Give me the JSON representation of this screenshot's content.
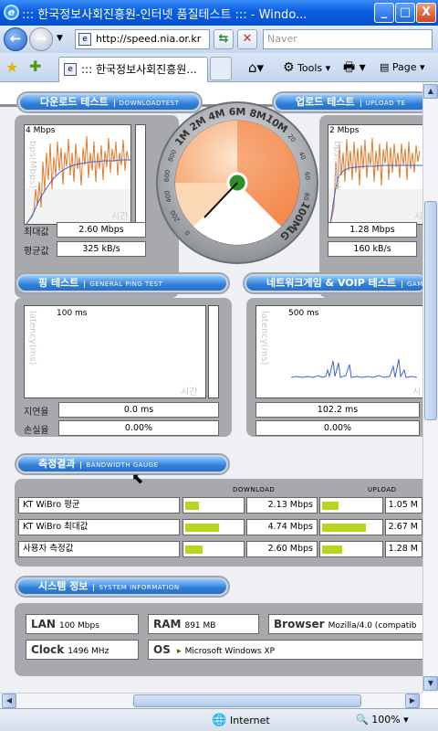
{
  "window": {
    "title": "::: 한국정보사회진흥원-인터넷 품질테스트 ::: - Windo...",
    "minimize": "_",
    "maximize": "□",
    "close": "X"
  },
  "addressbar": {
    "url": "http://speed.nia.or.kr",
    "search_placeholder": "Naver"
  },
  "tabs": {
    "active_tab": "::: 한국정보사회진흥원...",
    "tools_label": "Tools",
    "page_label": "Page"
  },
  "download": {
    "header": "다운로드 테스트",
    "header_sub": "DOWNLOADTEST",
    "scale_label": "4 Mbps",
    "y_axis": "bps(Mbps)",
    "x_axis": "시간",
    "max_label": "최대값",
    "avg_label": "평균값",
    "max_value": "2.60 Mbps",
    "avg_value": "325 kB/s"
  },
  "upload": {
    "header": "업로드 테스트",
    "header_sub": "UPLOAD TE",
    "scale_label": "2 Mbps",
    "y_axis": "bps(Mbps)",
    "x_axis": "시",
    "max_value": "1.28 Mbps",
    "avg_value": "160 kB/s"
  },
  "gauge": {
    "labels": [
      "0",
      "200",
      "400",
      "600",
      "800",
      "1M",
      "2M",
      "4M",
      "6M",
      "8M",
      "10M",
      "20",
      "40",
      "60",
      "80",
      "100M",
      "1G"
    ],
    "needle_value": "2.60 Mbps"
  },
  "ping": {
    "header": "핑 테스트",
    "header_sub": "GENERAL PING TEST",
    "scale_label": "100 ms",
    "y_axis": "latency(ms)",
    "x_axis": "시간",
    "delay_label": "지연율",
    "loss_label": "손실율",
    "delay_value": "0.0 ms",
    "loss_value": "0.00%"
  },
  "game": {
    "header": "네트워크게임 & VOIP 테스트",
    "header_sub": "GAME",
    "scale_label": "500 ms",
    "y_axis": "latency(ms)",
    "x_axis": "시",
    "delay_value": "102.2 ms",
    "loss_value": "0.00%"
  },
  "results": {
    "header": "측정결과",
    "header_sub": "BANDWIDTH GAUGE",
    "download_col": "DOWNLOAD",
    "upload_col": "UPLOAD",
    "rows": [
      {
        "label": "KT WiBro 평균",
        "down_value": "2.13 Mbps",
        "down_fraction": 0.24,
        "up_value": "1.05 M",
        "up_fraction": 0.28
      },
      {
        "label": "KT WiBro 최대값",
        "down_value": "4.74 Mbps",
        "down_fraction": 0.58,
        "up_value": "2.67 M",
        "up_fraction": 0.72
      },
      {
        "label": "사용자 측정값",
        "down_value": "2.60 Mbps",
        "down_fraction": 0.3,
        "up_value": "1.28 M",
        "up_fraction": 0.33
      }
    ]
  },
  "system": {
    "header": "시스템 정보",
    "header_sub": "SYSTEM INFORMATION",
    "lan_label": "LAN",
    "lan_value": "100 Mbps",
    "ram_label": "RAM",
    "ram_value": "891 MB",
    "browser_label": "Browser",
    "browser_value": "Mozilla/4.0 (compatib",
    "clock_label": "Clock",
    "clock_value": "1496 MHz",
    "os_label": "OS",
    "os_value": "Microsoft Windows XP"
  },
  "status": {
    "zone": "Internet",
    "zoom": "100%"
  }
}
